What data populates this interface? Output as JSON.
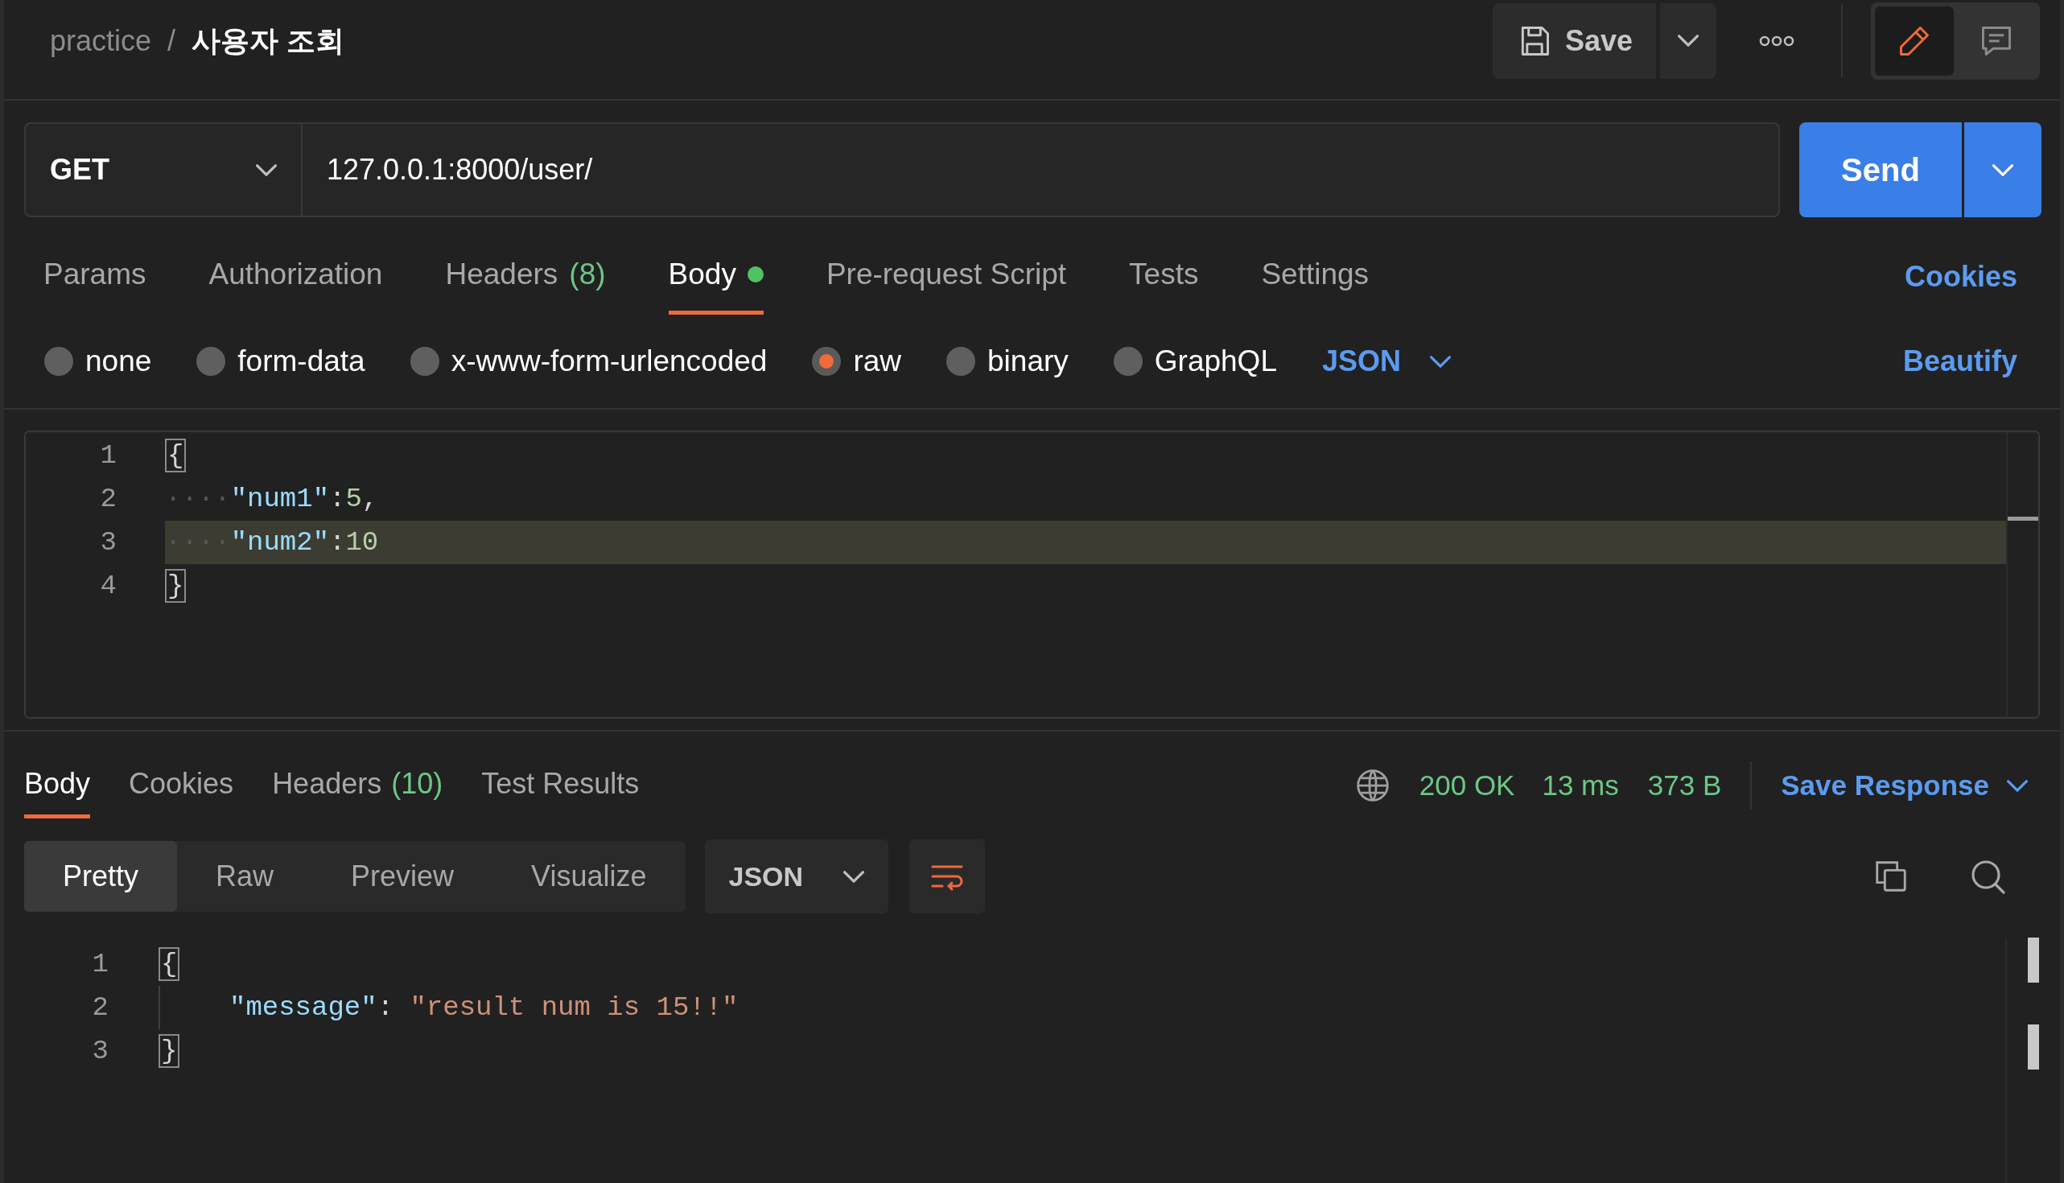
{
  "breadcrumb": {
    "collection": "practice",
    "separator": "/",
    "request": "사용자 조회"
  },
  "toolbar": {
    "save": "Save",
    "modes": [
      {
        "kind": "edit",
        "selected": true
      },
      {
        "kind": "comments",
        "selected": false
      }
    ]
  },
  "request": {
    "method": "GET",
    "url": "127.0.0.1:8000/user/",
    "send": "Send"
  },
  "tabs": [
    {
      "label": "Params",
      "selected": false,
      "dot": false
    },
    {
      "label": "Authorization",
      "selected": false,
      "dot": false
    },
    {
      "label": "Headers",
      "count": "(8)",
      "selected": false,
      "dot": false
    },
    {
      "label": "Body",
      "selected": true,
      "dot": true
    },
    {
      "label": "Pre-request Script",
      "selected": false,
      "dot": false
    },
    {
      "label": "Tests",
      "selected": false,
      "dot": false
    },
    {
      "label": "Settings",
      "selected": false,
      "dot": false
    }
  ],
  "cookies": "Cookies",
  "body_types": [
    {
      "label": "none",
      "selected": false
    },
    {
      "label": "form-data",
      "selected": false
    },
    {
      "label": "x-www-form-urlencoded",
      "selected": false
    },
    {
      "label": "raw",
      "selected": true
    },
    {
      "label": "binary",
      "selected": false
    },
    {
      "label": "GraphQL",
      "selected": false
    }
  ],
  "body_format": "JSON",
  "beautify": "Beautify",
  "editor": [
    {
      "number": "1",
      "highlighted": false,
      "tokens": [
        {
          "kind": "brace",
          "text": "{"
        }
      ]
    },
    {
      "number": "2",
      "highlighted": false,
      "tokens": [
        {
          "kind": "whitespace",
          "text": "····"
        },
        {
          "kind": "key",
          "text": "\"num1\""
        },
        {
          "kind": "punct",
          "text": ":"
        },
        {
          "kind": "number",
          "text": "5"
        },
        {
          "kind": "punct",
          "text": ","
        }
      ]
    },
    {
      "number": "3",
      "highlighted": true,
      "tokens": [
        {
          "kind": "whitespace",
          "text": "····"
        },
        {
          "kind": "key",
          "text": "\"num2\""
        },
        {
          "kind": "punct",
          "text": ":"
        },
        {
          "kind": "number",
          "text": "10"
        }
      ]
    },
    {
      "number": "4",
      "highlighted": false,
      "tokens": [
        {
          "kind": "brace",
          "text": "}"
        }
      ]
    }
  ],
  "response": {
    "tabs": [
      {
        "label": "Body",
        "selected": true
      },
      {
        "label": "Cookies",
        "selected": false
      },
      {
        "label": "Headers",
        "count": "(10)",
        "selected": false
      },
      {
        "label": "Test Results",
        "selected": false
      }
    ],
    "status": "200 OK",
    "time": "13 ms",
    "size": "373 B",
    "save_response": "Save Response",
    "views": [
      {
        "label": "Pretty",
        "selected": true
      },
      {
        "label": "Raw",
        "selected": false
      },
      {
        "label": "Preview",
        "selected": false
      },
      {
        "label": "Visualize",
        "selected": false
      }
    ],
    "format": "JSON",
    "lines": [
      {
        "number": "1",
        "indented": false,
        "tokens": [
          {
            "kind": "brace",
            "text": "{"
          }
        ]
      },
      {
        "number": "2",
        "indented": true,
        "tokens": [
          {
            "kind": "key",
            "text": "\"message\""
          },
          {
            "kind": "punct",
            "text": ": "
          },
          {
            "kind": "string",
            "text": "\"result num is 15!!\""
          }
        ]
      },
      {
        "number": "3",
        "indented": false,
        "tokens": [
          {
            "kind": "brace",
            "text": "}"
          }
        ]
      }
    ]
  }
}
